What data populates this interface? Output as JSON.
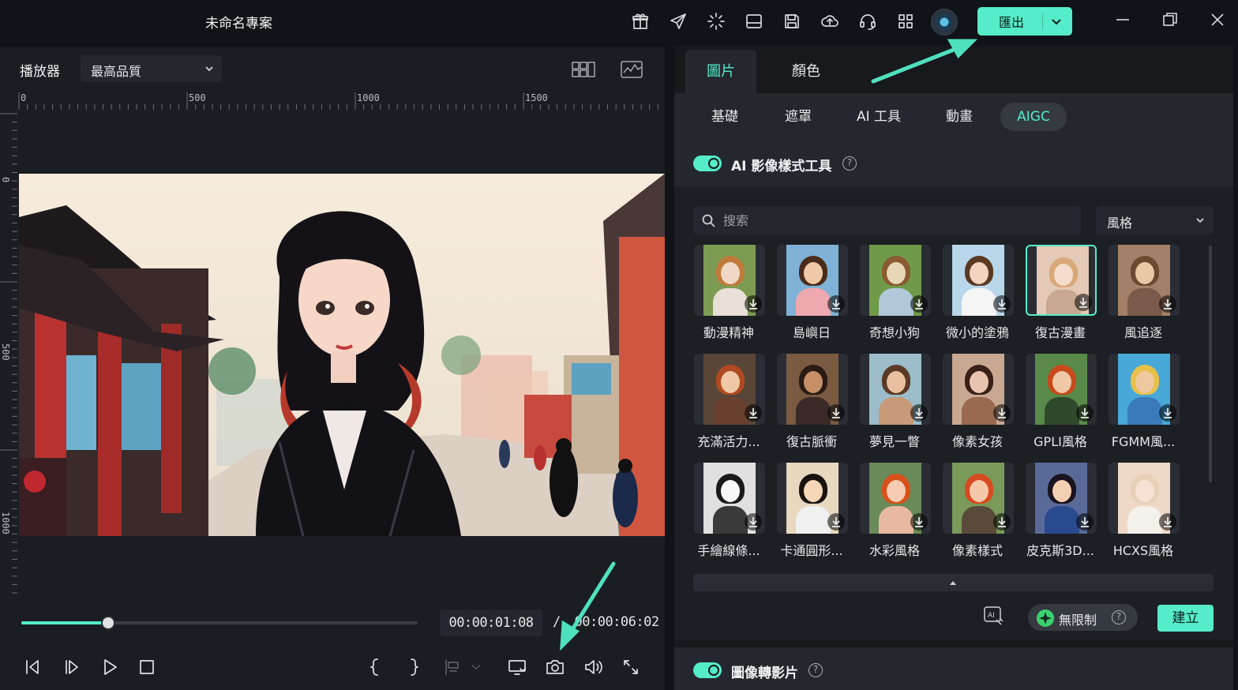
{
  "title_bar": {
    "project_title": "未命名專案",
    "export_label": "匯出",
    "icons": [
      "gift-icon",
      "send-icon",
      "loading-icon",
      "layout-icon",
      "save-icon",
      "cloud-upload-icon",
      "headset-icon",
      "apps-grid-icon"
    ]
  },
  "player": {
    "label": "播放器",
    "quality": "最高品質",
    "ruler_top": [
      "0",
      "500",
      "1000",
      "1500"
    ],
    "ruler_left": [
      "0",
      "500",
      "1000"
    ],
    "progress_fraction": 0.22,
    "current_time": "00:00:01:08",
    "separator": "/",
    "total_time": "00:00:06:02"
  },
  "right_panel": {
    "tabs": [
      {
        "label": "圖片",
        "active": true
      },
      {
        "label": "顏色",
        "active": false
      }
    ],
    "subtabs": [
      {
        "label": "基礎",
        "active": false
      },
      {
        "label": "遮罩",
        "active": false
      },
      {
        "label": "AI 工具",
        "active": false
      },
      {
        "label": "動畫",
        "active": false
      },
      {
        "label": "AIGC",
        "active": true
      }
    ],
    "ai_style_section": {
      "title": "AI 影像樣式工具",
      "enabled": true,
      "search_placeholder": "搜索",
      "filter_value": "風格",
      "styles": [
        {
          "label": "動漫精神",
          "selected": false
        },
        {
          "label": "島嶼日",
          "selected": false
        },
        {
          "label": "奇想小狗",
          "selected": false
        },
        {
          "label": "微小的塗鴉",
          "selected": false
        },
        {
          "label": "復古漫畫",
          "selected": true
        },
        {
          "label": "風追逐",
          "selected": false
        },
        {
          "label": "充滿活力...",
          "selected": false
        },
        {
          "label": "復古脈衝",
          "selected": false
        },
        {
          "label": "夢見一瞥",
          "selected": false
        },
        {
          "label": "像素女孩",
          "selected": false
        },
        {
          "label": "GPLI風格",
          "selected": false
        },
        {
          "label": "FGMM風...",
          "selected": false
        },
        {
          "label": "手繪線條...",
          "selected": false
        },
        {
          "label": "卡通圓形...",
          "selected": false
        },
        {
          "label": "水彩風格",
          "selected": false
        },
        {
          "label": "像素樣式",
          "selected": false
        },
        {
          "label": "皮克斯3D...",
          "selected": false
        },
        {
          "label": "HCXS風格",
          "selected": false
        }
      ],
      "unlimited_label": "無限制",
      "create_label": "建立"
    },
    "image_to_video_section": {
      "title": "圖像轉影片",
      "enabled": true
    }
  },
  "colors": {
    "accent": "#55ecc9",
    "panel_bg": "#1c1f23",
    "title_bg": "#101318"
  }
}
